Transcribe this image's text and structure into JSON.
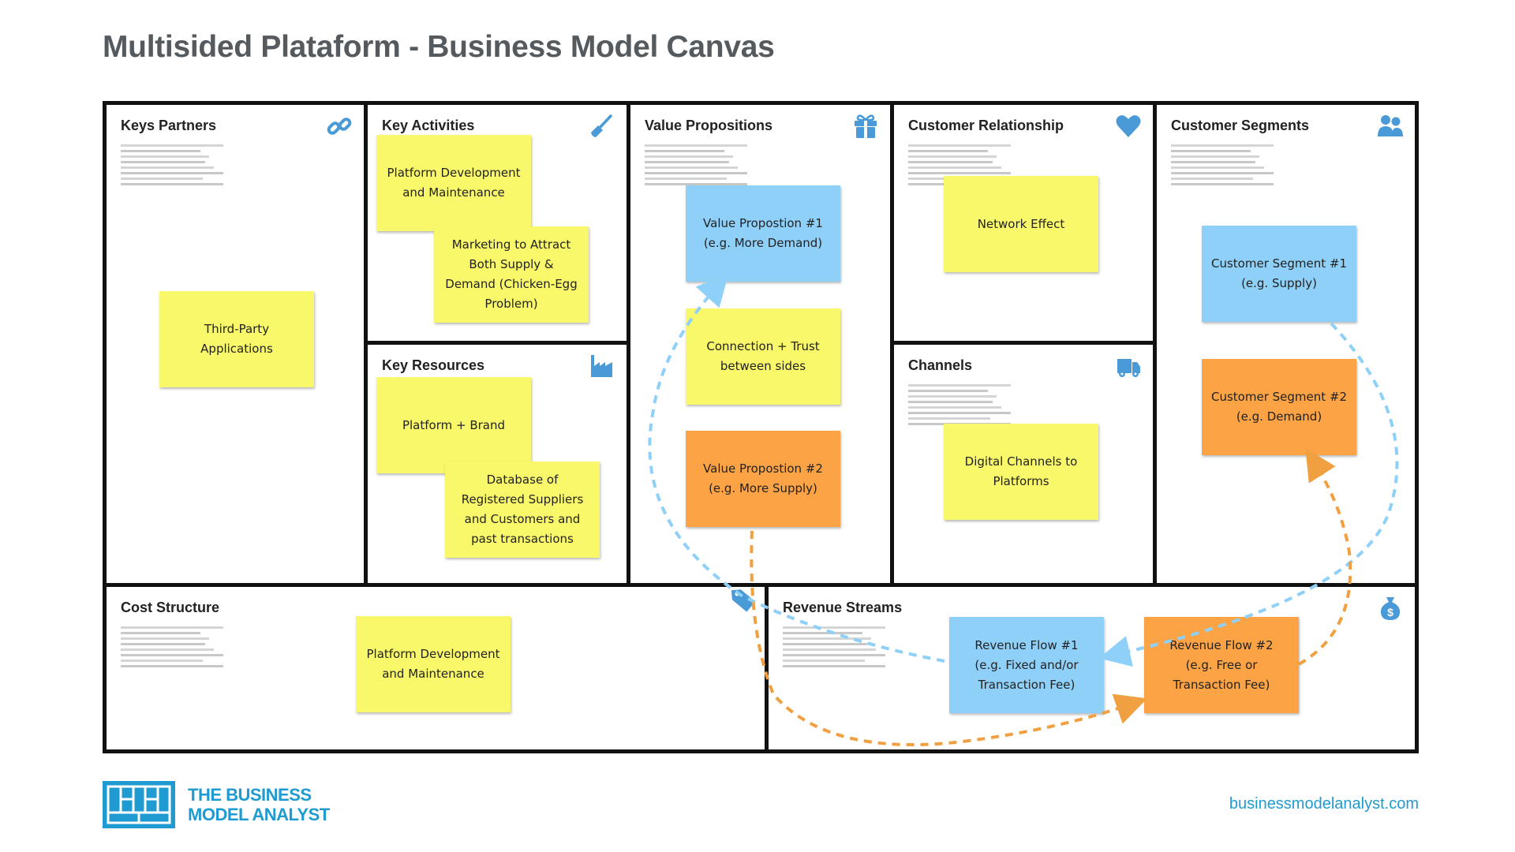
{
  "title": "Multisided Plataform - Business Model Canvas",
  "colors": {
    "sticky_yellow": "#f9f86a",
    "sticky_blue": "#8fd0f8",
    "sticky_orange": "#fba345",
    "icon_blue": "#4a9ad8",
    "flow_blue": "#8fd0f8",
    "flow_orange": "#f0a040",
    "brand_blue": "#1f9bd1"
  },
  "blocks": {
    "key_partners": {
      "title": "Keys Partners",
      "icon": "link-icon",
      "notes": [
        "Third-Party Applications"
      ]
    },
    "key_activities": {
      "title": "Key Activities",
      "icon": "shovel-icon",
      "notes": [
        "Platform Development and Maintenance",
        "Marketing to Attract Both Supply & Demand (Chicken-Egg Problem)"
      ]
    },
    "key_resources": {
      "title": "Key Resources",
      "icon": "factory-icon",
      "notes": [
        "Platform + Brand",
        "Database of Registered Suppliers and Customers and past transactions"
      ]
    },
    "value_propositions": {
      "title": "Value Propositions",
      "icon": "gift-icon",
      "notes": [
        "Value Propostion #1\n(e.g. More Demand)",
        "Connection + Trust\nbetween sides",
        "Value Propostion #2\n(e.g. More Supply)"
      ]
    },
    "customer_relationship": {
      "title": "Customer Relationship",
      "icon": "heart-icon",
      "notes": [
        "Network Effect"
      ]
    },
    "channels": {
      "title": "Channels",
      "icon": "truck-icon",
      "notes": [
        "Digital Channels to Platforms"
      ]
    },
    "customer_segments": {
      "title": "Customer Segments",
      "icon": "users-icon",
      "notes": [
        "Customer Segment #1\n(e.g. Supply)",
        "Customer Segment #2\n(e.g. Demand)"
      ]
    },
    "cost_structure": {
      "title": "Cost Structure",
      "icon": "price-tag-icon",
      "notes": [
        "Platform Development and Maintenance"
      ]
    },
    "revenue_streams": {
      "title": "Revenue Streams",
      "icon": "money-bag-icon",
      "notes": [
        "Revenue Flow #1\n(e.g. Fixed and/or\nTransaction Fee)",
        "Revenue Flow #2\n(e.g. Free or\nTransaction Fee)"
      ]
    }
  },
  "flows": [
    {
      "name": "blue-flow",
      "color": "blue",
      "from": "Customer Segment #1",
      "via": "Revenue Flow #1",
      "to": "Value Propostion #1"
    },
    {
      "name": "orange-flow",
      "color": "orange",
      "from": "Value Propostion #2",
      "via": "Revenue Flow #2",
      "to": "Customer Segment #2"
    }
  ],
  "footer": {
    "brand_line1": "THE BUSINESS",
    "brand_line2": "MODEL ANALYST",
    "website": "businessmodelanalyst.com"
  }
}
